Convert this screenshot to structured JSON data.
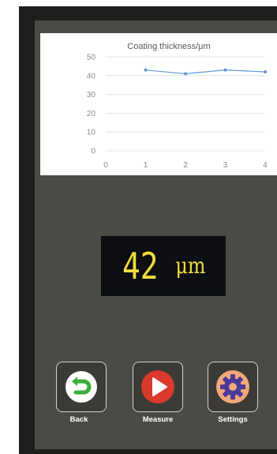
{
  "colors": {
    "screen_bg": "#4b4a45",
    "readout_text": "#f0de3c",
    "line": "#5b9bd5",
    "back_icon": "#3aae3a",
    "measure_icon": "#d93a2b",
    "settings_icon": "#f2a77a"
  },
  "reading": {
    "value": "42",
    "unit": "μm"
  },
  "buttons": {
    "back": {
      "label": "Back",
      "icon": "back-arrow-icon"
    },
    "measure": {
      "label": "Measure",
      "icon": "play-icon"
    },
    "settings": {
      "label": "Settings",
      "icon": "gear-icon"
    }
  },
  "chart_data": {
    "type": "line",
    "title": "Coating thickness/μm",
    "x": [
      1,
      2,
      3,
      4
    ],
    "series": [
      {
        "values": [
          43,
          41,
          43,
          42
        ]
      }
    ],
    "xlim": [
      0,
      4
    ],
    "ylim": [
      0,
      50
    ],
    "xticks": [
      "0",
      "1",
      "2",
      "3",
      "4"
    ],
    "yticks": [
      "0",
      "10",
      "20",
      "30",
      "40",
      "50"
    ],
    "grid": true
  }
}
